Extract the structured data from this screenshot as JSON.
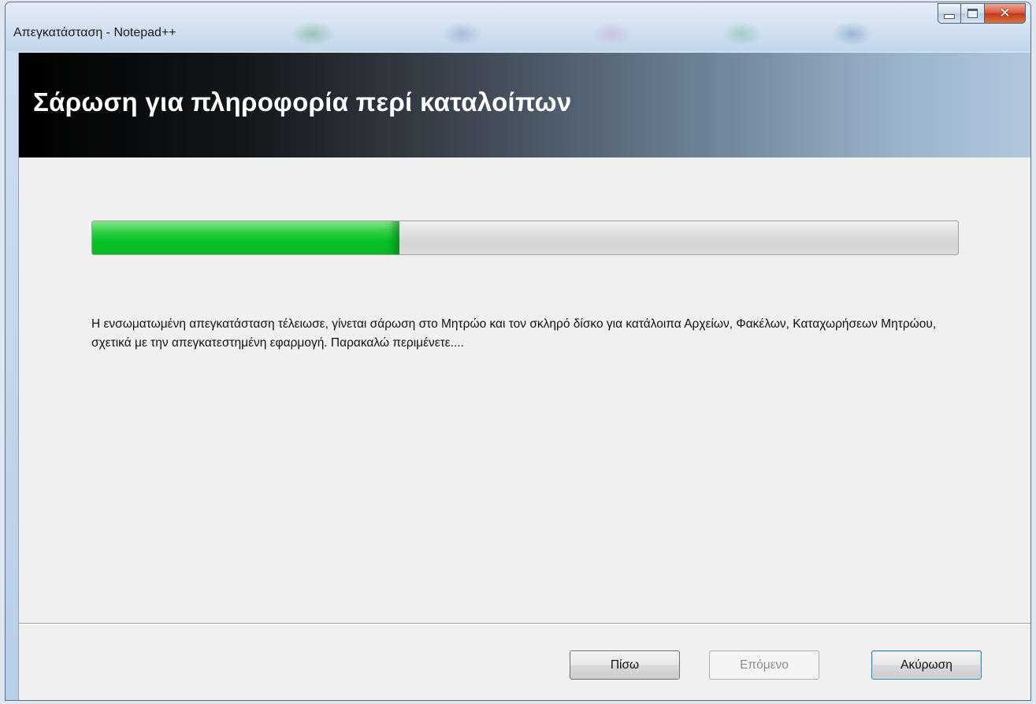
{
  "window": {
    "title": "Απεγκατάσταση - Notepad++",
    "controls": {
      "minimize": "minimize-icon",
      "maximize": "maximize-icon",
      "close": "close-icon"
    }
  },
  "banner": {
    "title": "Σάρωση για πληροφορία περί καταλοίπων"
  },
  "progress": {
    "fraction": 0.355,
    "fill_color": "#05c223"
  },
  "message": {
    "text": "Η ενσωματωμένη απεγκατάσταση τέλειωσε, γίνεται σάρωση στο Μητρώο και τον σκληρό δίσκο για κατάλοιπα Αρχείων, Φακέλων, Καταχωρήσεων Μητρώου, σχετικά με την απεγκατεστημένη εφαρμογή. Παρακαλώ περιμένετε...."
  },
  "buttons": {
    "back": "Πίσω",
    "next": "Επόμενο",
    "cancel": "Ακύρωση"
  }
}
